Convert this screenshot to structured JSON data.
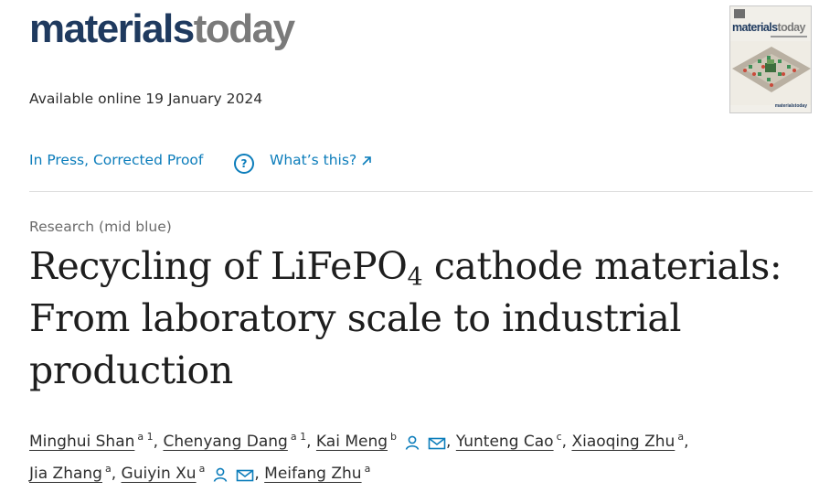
{
  "journal": {
    "name_part1": "materials",
    "name_part2": "today"
  },
  "cover": {
    "name_part1": "materials",
    "name_part2": "today",
    "footer": "materialstoday"
  },
  "available_online": "Available online 19 January 2024",
  "status": {
    "label": "In Press, Corrected Proof",
    "help_symbol": "?",
    "whats_this": "What’s this?"
  },
  "article_type": "Research (mid blue)",
  "title": {
    "part1": "Recycling of LiFePO",
    "subscript": "4",
    "part2": " cathode materials: From laboratory scale to industrial production"
  },
  "authors": [
    {
      "name": "Minghui Shan",
      "affiliation": "a 1"
    },
    {
      "name": "Chenyang Dang",
      "affiliation": "a 1"
    },
    {
      "name": "Kai Meng",
      "affiliation": "b",
      "icons": [
        "person-icon",
        "mail-icon"
      ]
    },
    {
      "name": "Yunteng Cao",
      "affiliation": "c"
    },
    {
      "name": "Xiaoqing Zhu",
      "affiliation": "a"
    },
    {
      "name": "Jia Zhang",
      "affiliation": "a"
    },
    {
      "name": "Guiyin Xu",
      "affiliation": "a",
      "icons": [
        "person-icon",
        "mail-icon"
      ]
    },
    {
      "name": "Meifang Zhu",
      "affiliation": "a"
    }
  ],
  "separator": ",",
  "colors": {
    "link": "#0c7dbb",
    "brand_navy": "#1f3a5f",
    "brand_gray": "#7a7a7a",
    "text": "#2e2e2e"
  }
}
